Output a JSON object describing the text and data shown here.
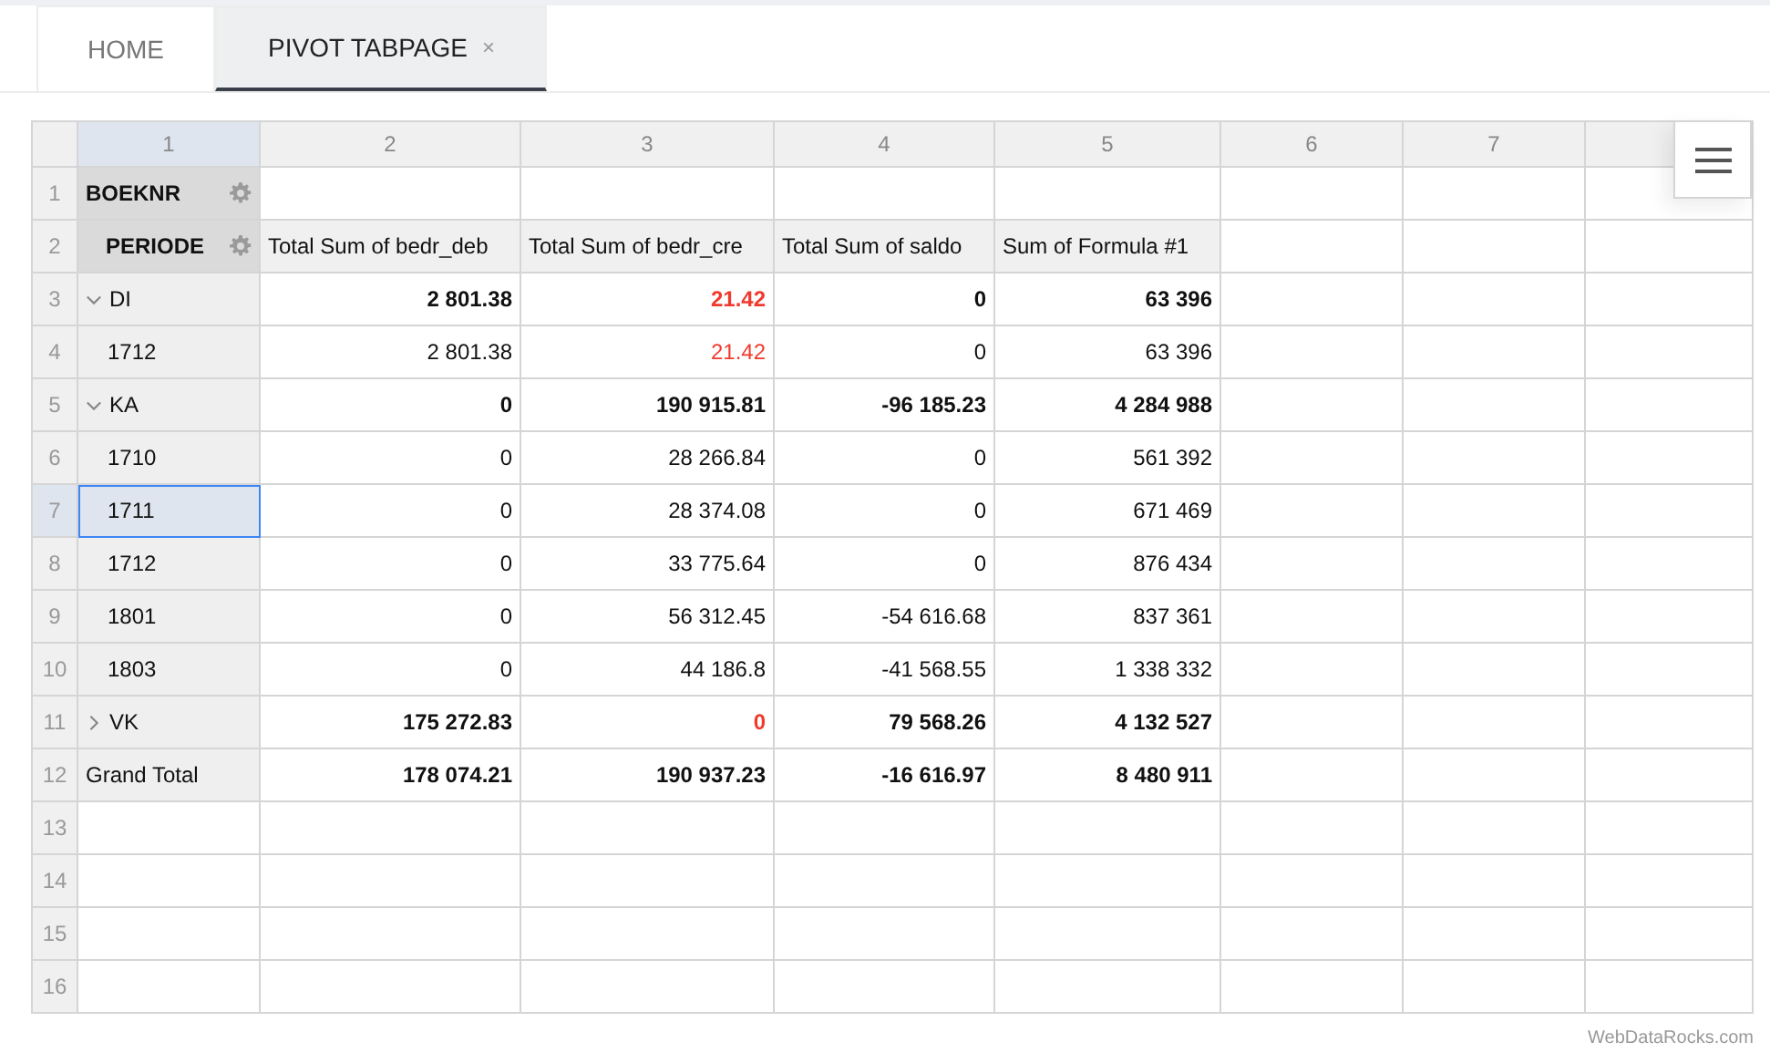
{
  "tabs": [
    {
      "label": "HOME",
      "selected": false
    },
    {
      "label": "PIVOT TABPAGE",
      "selected": true,
      "close": "×"
    }
  ],
  "grid": {
    "columns": [
      {
        "label": "1",
        "selected": true
      },
      {
        "label": "2",
        "selected": false
      },
      {
        "label": "3",
        "selected": false
      },
      {
        "label": "4",
        "selected": false
      },
      {
        "label": "5",
        "selected": false
      },
      {
        "label": "6",
        "selected": false
      },
      {
        "label": "7",
        "selected": false
      }
    ],
    "rows": [
      {
        "number": "1",
        "kind": "column_field",
        "label": "BOEKNR",
        "selected": false,
        "values": []
      },
      {
        "number": "2",
        "kind": "row_field",
        "label": "PERIODE",
        "selected": false,
        "values": [
          {
            "text": "Total Sum of bedr_deb",
            "flagged": false
          },
          {
            "text": "Total Sum of bedr_cre",
            "flagged": false
          },
          {
            "text": "Total Sum of saldo",
            "flagged": false
          },
          {
            "text": "Sum of Formula #1",
            "flagged": false
          }
        ]
      },
      {
        "number": "3",
        "kind": "group",
        "label": "DI",
        "expanded": true,
        "selected": false,
        "values": [
          {
            "text": "2 801.38",
            "flagged": false
          },
          {
            "text": "21.42",
            "flagged": true
          },
          {
            "text": "0",
            "flagged": false
          },
          {
            "text": "63 396",
            "flagged": false
          }
        ]
      },
      {
        "number": "4",
        "kind": "item",
        "label": "1712",
        "selected": false,
        "values": [
          {
            "text": "2 801.38",
            "flagged": false
          },
          {
            "text": "21.42",
            "flagged": true
          },
          {
            "text": "0",
            "flagged": false
          },
          {
            "text": "63 396",
            "flagged": false
          }
        ]
      },
      {
        "number": "5",
        "kind": "group",
        "label": "KA",
        "expanded": true,
        "selected": false,
        "values": [
          {
            "text": "0",
            "flagged": false
          },
          {
            "text": "190 915.81",
            "flagged": false
          },
          {
            "text": "-96 185.23",
            "flagged": false
          },
          {
            "text": "4 284 988",
            "flagged": false
          }
        ]
      },
      {
        "number": "6",
        "kind": "item",
        "label": "1710",
        "selected": false,
        "values": [
          {
            "text": "0",
            "flagged": false
          },
          {
            "text": "28 266.84",
            "flagged": false
          },
          {
            "text": "0",
            "flagged": false
          },
          {
            "text": "561 392",
            "flagged": false
          }
        ]
      },
      {
        "number": "7",
        "kind": "item",
        "label": "1711",
        "selected": true,
        "values": [
          {
            "text": "0",
            "flagged": false
          },
          {
            "text": "28 374.08",
            "flagged": false
          },
          {
            "text": "0",
            "flagged": false
          },
          {
            "text": "671 469",
            "flagged": false
          }
        ]
      },
      {
        "number": "8",
        "kind": "item",
        "label": "1712",
        "selected": false,
        "values": [
          {
            "text": "0",
            "flagged": false
          },
          {
            "text": "33 775.64",
            "flagged": false
          },
          {
            "text": "0",
            "flagged": false
          },
          {
            "text": "876 434",
            "flagged": false
          }
        ]
      },
      {
        "number": "9",
        "kind": "item",
        "label": "1801",
        "selected": false,
        "values": [
          {
            "text": "0",
            "flagged": false
          },
          {
            "text": "56 312.45",
            "flagged": false
          },
          {
            "text": "-54 616.68",
            "flagged": false
          },
          {
            "text": "837 361",
            "flagged": false
          }
        ]
      },
      {
        "number": "10",
        "kind": "item",
        "label": "1803",
        "selected": false,
        "values": [
          {
            "text": "0",
            "flagged": false
          },
          {
            "text": "44 186.8",
            "flagged": false
          },
          {
            "text": "-41 568.55",
            "flagged": false
          },
          {
            "text": "1 338 332",
            "flagged": false
          }
        ]
      },
      {
        "number": "11",
        "kind": "group",
        "label": "VK",
        "expanded": false,
        "selected": false,
        "values": [
          {
            "text": "175 272.83",
            "flagged": false
          },
          {
            "text": "0",
            "flagged": true
          },
          {
            "text": "79 568.26",
            "flagged": false
          },
          {
            "text": "4 132 527",
            "flagged": false
          }
        ]
      },
      {
        "number": "12",
        "kind": "total",
        "label": "Grand Total",
        "selected": false,
        "values": [
          {
            "text": "178 074.21",
            "flagged": false
          },
          {
            "text": "190 937.23",
            "flagged": false
          },
          {
            "text": "-16 616.97",
            "flagged": false
          },
          {
            "text": "8 480 911",
            "flagged": false
          }
        ]
      },
      {
        "number": "13",
        "kind": "empty",
        "selected": false,
        "values": []
      },
      {
        "number": "14",
        "kind": "empty",
        "selected": false,
        "values": []
      },
      {
        "number": "15",
        "kind": "empty",
        "selected": false,
        "values": []
      },
      {
        "number": "16",
        "kind": "empty",
        "selected": false,
        "values": []
      }
    ]
  },
  "credit": "WebDataRocks.com"
}
